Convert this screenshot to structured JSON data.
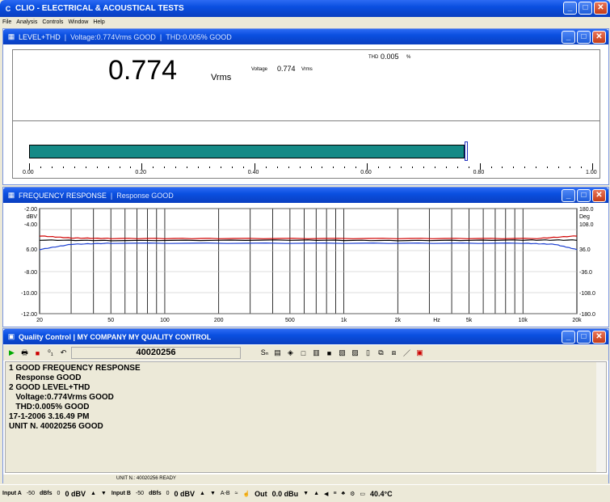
{
  "app": {
    "title": "CLIO - ELECTRICAL & ACOUSTICAL TESTS"
  },
  "menu": [
    "File",
    "Analysis",
    "Controls",
    "Window",
    "Help"
  ],
  "level_window": {
    "title": "LEVEL+THD",
    "sep1": "|",
    "voltage_status": "Voltage:0.774Vrms GOOD",
    "sep2": "|",
    "thd_status": "THD:0.005% GOOD",
    "big_value": "0.774",
    "big_unit": "Vrms",
    "voltage_label": "Voltage",
    "voltage_value": "0.774",
    "voltage_unit": "Vrms",
    "thd_label": "THD",
    "thd_value": "0.005",
    "thd_unit": "%",
    "meter_fraction": 0.774,
    "meter_ticks": [
      "0.00",
      "0.20",
      "0.40",
      "0.60",
      "0.80",
      "1.00"
    ],
    "bar_color": "#158a87"
  },
  "freq_window": {
    "title": "FREQUENCY RESPONSE",
    "sep": "|",
    "status": "Response GOOD",
    "chart_data": {
      "type": "line",
      "x_ticks": [
        "20",
        "50",
        "100",
        "200",
        "500",
        "1k",
        "2k",
        "Hz",
        "5k",
        "10k",
        "20k"
      ],
      "left_ticks": [
        "-2.00",
        "dBV",
        "-4.00",
        "6.00",
        "-8.00",
        "-10.00",
        "-12.00"
      ],
      "right_ticks": [
        "180.0",
        "Deg",
        "108.0",
        "36.0",
        "-36.0",
        "-108.0",
        "-180.0"
      ],
      "series": [
        {
          "color": "#d00000",
          "points": [
            [
              20,
              -4.6
            ],
            [
              30,
              -4.8
            ],
            [
              50,
              -4.85
            ],
            [
              200,
              -4.85
            ],
            [
              2000,
              -4.85
            ],
            [
              12000,
              -4.85
            ],
            [
              20000,
              -4.6
            ]
          ]
        },
        {
          "color": "#000000",
          "points": [
            [
              20,
              -5.0
            ],
            [
              50,
              -5.05
            ],
            [
              500,
              -5.0
            ],
            [
              2000,
              -5.05
            ],
            [
              10000,
              -5.0
            ],
            [
              20000,
              -5.0
            ]
          ]
        },
        {
          "color": "#1c3fd0",
          "points": [
            [
              20,
              -5.9
            ],
            [
              30,
              -5.4
            ],
            [
              50,
              -5.3
            ],
            [
              1000,
              -5.3
            ],
            [
              10000,
              -5.3
            ],
            [
              15000,
              -5.4
            ],
            [
              20000,
              -5.9
            ]
          ]
        }
      ],
      "xlim": [
        20,
        20000
      ],
      "ylim": [
        -12,
        -2
      ]
    }
  },
  "qc_window": {
    "title": "Quality Control | MY COMPANY  MY QUALITY CONTROL",
    "serial": "40020256",
    "lines": [
      "1 GOOD FREQUENCY RESPONSE",
      "   Response GOOD",
      "2 GOOD LEVEL+THD",
      "   Voltage:0.774Vrms GOOD",
      "   THD:0.005% GOOD",
      "17-1-2006 3.16.49 PM",
      "UNIT N. 40020256 GOOD"
    ],
    "status": "UNIT N.: 40020256 READY"
  },
  "statusbar": {
    "input_a": "Input A",
    "input_a_range": "-50",
    "dbfs_a": "dBfs",
    "zero_a": "0",
    "level_a": "0 dBV",
    "input_b": "Input B",
    "input_b_range": "-50",
    "dbfs_b": "dBfs",
    "zero_b": "0",
    "level_b": "0 dBV",
    "ab": "A-B",
    "out_label": "Out",
    "out_value": "0.0 dBu",
    "temp": "40.4°C"
  }
}
